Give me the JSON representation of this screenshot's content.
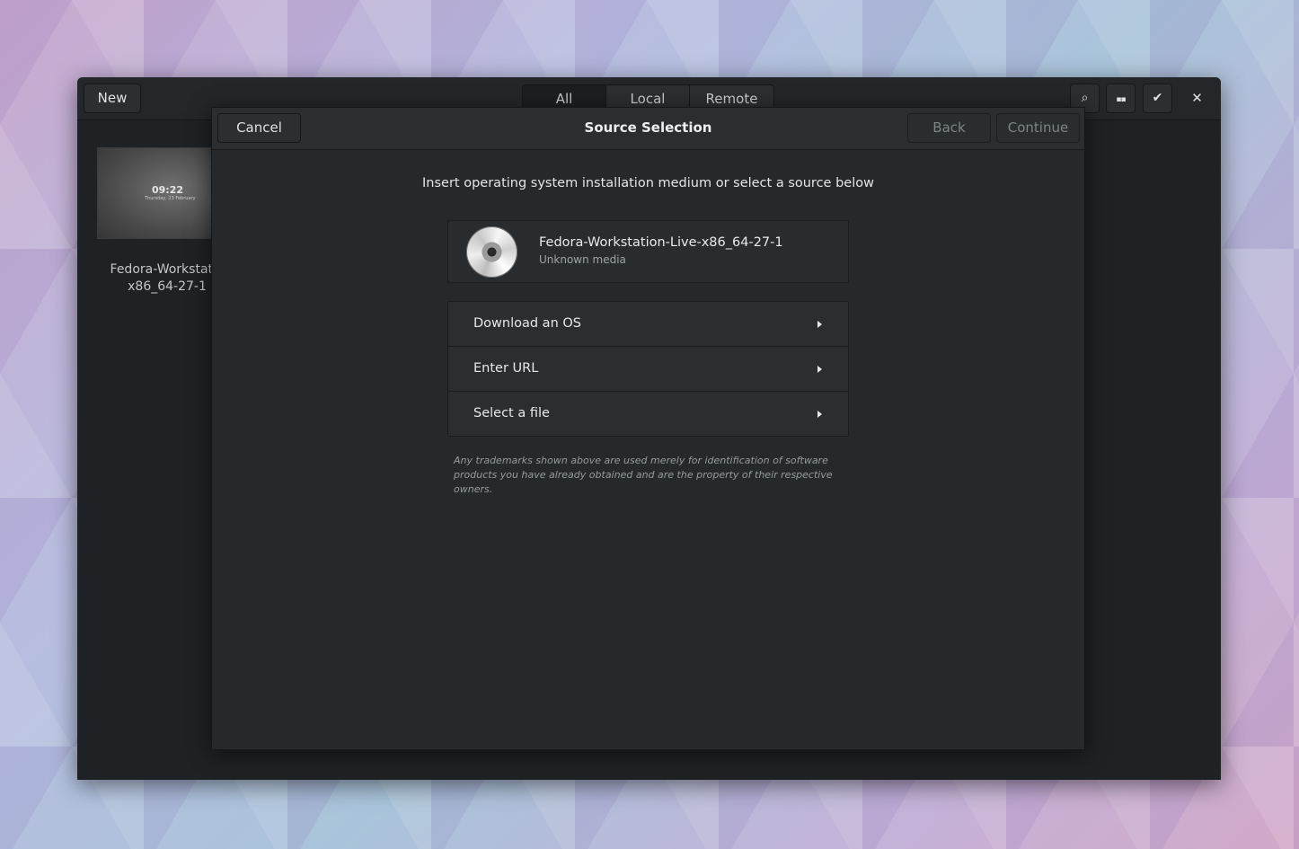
{
  "main_window": {
    "new_button": "New",
    "view_tabs": [
      {
        "label": "All",
        "active": true
      },
      {
        "label": "Local",
        "active": false
      },
      {
        "label": "Remote",
        "active": false
      }
    ],
    "icons": {
      "search": "search-icon",
      "selection_mode": "list-view-icon",
      "check": "checkmark-icon",
      "close": "close-icon"
    },
    "glyphs": {
      "search": "⌕",
      "selection_mode": "▪▪",
      "check": "✔",
      "close": "✕"
    },
    "thumbnail": {
      "time": "09:22",
      "date": "Thursday, 23 February",
      "label_line1": "Fedora-Workstatio",
      "label_line2": "x86_64-27-1"
    }
  },
  "dialog": {
    "title": "Source Selection",
    "cancel_label": "Cancel",
    "back_label": "Back",
    "continue_label": "Continue",
    "instructions": "Insert operating system installation medium or select a source below",
    "media": {
      "name": "Fedora-Workstation-Live-x86_64-27-1",
      "subtitle": "Unknown media"
    },
    "sources": [
      {
        "label": "Download an OS"
      },
      {
        "label": "Enter URL"
      },
      {
        "label": "Select a file"
      }
    ],
    "trademark_note": "Any trademarks shown above are used merely for identification of software products you have already obtained and are the property of their respective owners."
  }
}
